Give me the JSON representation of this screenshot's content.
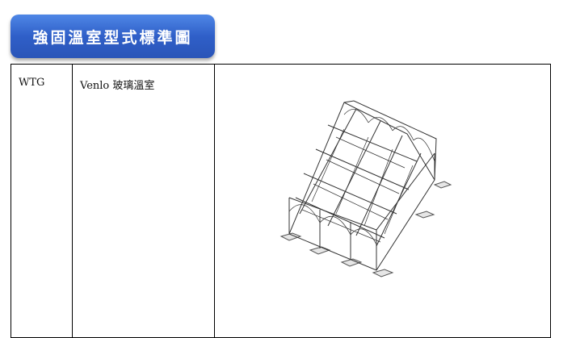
{
  "header": {
    "title": "強固溫室型式標準圖"
  },
  "table": {
    "rows": [
      {
        "code": "WTG",
        "name": "Venlo 玻璃溫室",
        "image_icon": "greenhouse-frame-drawing"
      }
    ]
  }
}
